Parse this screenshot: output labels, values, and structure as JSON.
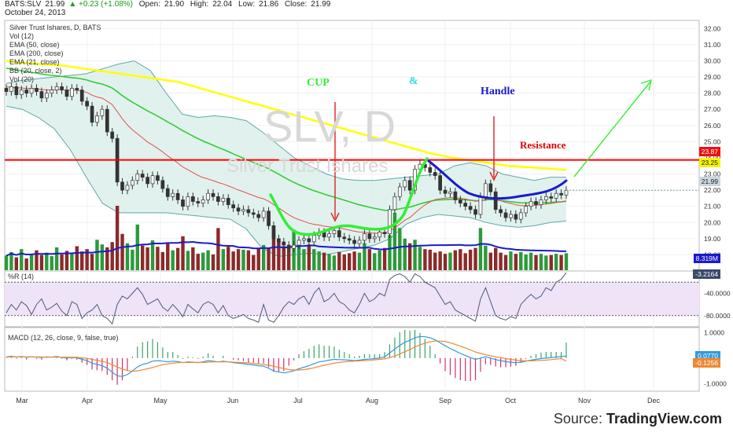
{
  "header": {
    "symbol": "BATS:SLV",
    "price": "21.99",
    "change": "▲ +0.23 (+1.08%)",
    "open_label": "Open:",
    "open": "21.90",
    "high_label": "High:",
    "high": "22.04",
    "low_label": "Low:",
    "low": "21.86",
    "close_label": "Close:",
    "close": "21.99",
    "date": "October 24, 2013"
  },
  "legend": [
    "Silver Trust Ishares, D, BATS",
    "Vol (12)",
    "EMA (50, close)",
    "EMA (200, close)",
    "EMA (21, close)",
    "BB (20, close, 2)",
    "Vol (20)"
  ],
  "watermark": {
    "big": "SLV, D",
    "small": "Silver Trust Ishares"
  },
  "annotations": {
    "cup": "CUP",
    "amp": "&",
    "handle": "Handle",
    "resistance": "Resistance"
  },
  "price_tags": {
    "resistance": "23.87",
    "ema200": "23.25",
    "last": "21.99",
    "volume": "8.319M"
  },
  "indicator_labels": {
    "wr": "%R (14)",
    "wr_last": "-3.2164",
    "macd": "MACD (12, 26, close, 9, false, true)",
    "macd_1": "0.0770",
    "macd_2": "-0.1256"
  },
  "source": {
    "prefix": "Source: ",
    "brand": "TradingView.com"
  },
  "colors": {
    "up": "#2e8b2e",
    "down": "#8b1a1a",
    "ema200": "#ffff00",
    "ema50": "#33cc33",
    "ema21": "#e05050",
    "bb": "#5fa8a8",
    "resistance": "#ff0000",
    "cup": "#33ee33",
    "handle": "#1a1acc",
    "arrow": "#33ee33",
    "macd": "#3399dd",
    "signal": "#ee8833"
  },
  "chart_data": {
    "type": "line",
    "title": "Silver Trust Ishares, D, BATS",
    "x_labels": [
      "Mar",
      "Apr",
      "May",
      "Jun",
      "Jul",
      "Aug",
      "Sep",
      "Oct",
      "Nov",
      "Dec"
    ],
    "price_axis": {
      "ylim": [
        17.0,
        32.5
      ],
      "ticks": [
        18.0,
        19.0,
        20.0,
        21.0,
        22.0,
        23.0,
        24.0,
        25.0,
        26.0,
        27.0,
        28.0,
        29.0,
        30.0,
        31.0,
        32.0
      ]
    },
    "wr_axis": {
      "ylim": [
        -100,
        0
      ],
      "ticks": [
        -40,
        -80
      ]
    },
    "macd_axis": {
      "ylim": [
        -1.3,
        1.2
      ],
      "ticks": [
        1.0,
        -1.0
      ]
    },
    "close_series": [
      28.1,
      28.4,
      27.9,
      28.2,
      28.0,
      28.3,
      28.1,
      27.7,
      28.0,
      28.2,
      28.4,
      28.2,
      27.8,
      28.3,
      28.2,
      27.5,
      27.2,
      26.2,
      26.6,
      27.0,
      25.6,
      25.2,
      22.5,
      22.0,
      22.3,
      22.6,
      23.0,
      22.8,
      22.4,
      22.9,
      22.6,
      22.1,
      21.6,
      21.8,
      21.4,
      21.0,
      21.6,
      21.3,
      21.2,
      21.4,
      21.8,
      21.6,
      21.3,
      21.5,
      21.1,
      20.9,
      20.7,
      20.8,
      20.6,
      20.5,
      20.3,
      20.7,
      19.8,
      19.0,
      18.8,
      18.6,
      18.4,
      18.6,
      18.9,
      19.0,
      18.8,
      19.2,
      19.4,
      19.1,
      19.3,
      19.5,
      19.1,
      19.0,
      18.9,
      18.7,
      18.9,
      19.3,
      19.0,
      19.1,
      19.4,
      19.3,
      20.8,
      21.6,
      22.2,
      22.6,
      22.0,
      23.3,
      23.6,
      23.4,
      23.1,
      22.9,
      22.0,
      21.8,
      21.9,
      21.4,
      21.2,
      21.0,
      20.8,
      20.5,
      21.6,
      22.4,
      21.9,
      20.8,
      20.6,
      20.3,
      20.5,
      20.2,
      20.6,
      21.0,
      21.3,
      21.1,
      21.4,
      21.6,
      21.5,
      21.8,
      21.7,
      21.99
    ],
    "ema200": [
      30.0,
      29.9,
      29.85,
      29.8,
      29.75,
      29.7,
      29.6,
      29.5,
      29.4,
      29.3,
      29.2,
      29.1,
      29.0,
      28.9,
      28.8,
      28.7,
      28.5,
      28.3,
      28.1,
      27.9,
      27.7,
      27.5,
      27.3,
      27.1,
      26.9,
      26.7,
      26.5,
      26.3,
      26.1,
      25.9,
      25.7,
      25.5,
      25.3,
      25.1,
      24.9,
      24.7,
      24.5,
      24.3,
      24.15,
      24.0,
      23.9,
      23.8,
      23.7,
      23.6,
      23.5,
      23.45,
      23.4,
      23.35,
      23.3,
      23.25
    ],
    "resistance": 23.87,
    "ema200_last": 23.25,
    "bb_upper": [
      28.6,
      28.8,
      28.9,
      29.0,
      29.1,
      29.2,
      29.5,
      29.8,
      30.0,
      29.4,
      28.0,
      26.7,
      26.5,
      26.6,
      26.5,
      26.3,
      25.6,
      24.8,
      24.0,
      23.5,
      23.0,
      22.7,
      22.6,
      22.6,
      22.7,
      22.8,
      22.9,
      23.0,
      23.5,
      23.7,
      23.5,
      23.0,
      22.8,
      22.6,
      22.8,
      22.8
    ],
    "bb_lower": [
      27.2,
      27.0,
      26.5,
      25.8,
      24.5,
      22.8,
      21.2,
      20.6,
      20.6,
      20.6,
      20.6,
      20.5,
      20.4,
      20.3,
      20.2,
      19.6,
      18.4,
      17.9,
      18.0,
      18.1,
      18.0,
      18.2,
      18.4,
      18.6,
      19.0,
      19.9,
      20.3,
      20.5,
      20.4,
      20.3,
      20.0,
      19.8,
      19.7,
      19.8,
      20.0,
      20.1
    ],
    "volume_max": 11,
    "volume_series": [
      2.5,
      3.1,
      2.2,
      3.6,
      2.0,
      2.8,
      3.4,
      2.6,
      3.0,
      2.4,
      3.9,
      2.7,
      3.3,
      2.9,
      4.1,
      3.2,
      3.6,
      2.8,
      5.2,
      4.4,
      3.9,
      4.8,
      11.0,
      6.2,
      4.6,
      3.5,
      7.8,
      4.2,
      3.9,
      5.1,
      4.0,
      3.1,
      4.6,
      3.4,
      3.8,
      5.8,
      3.3,
      3.9,
      2.8,
      3.0,
      3.4,
      2.7,
      7.2,
      3.6,
      4.0,
      3.2,
      3.6,
      3.5,
      3.4,
      2.6,
      3.8,
      4.3,
      3.7,
      6.4,
      5.0,
      4.1,
      3.8,
      6.9,
      4.2,
      3.6,
      4.4,
      3.6,
      3.2,
      3.0,
      2.8,
      2.5,
      3.1,
      2.7,
      2.9,
      3.2,
      3.0,
      4.6,
      3.6,
      2.9,
      3.4,
      3.8,
      6.0,
      9.8,
      7.2,
      5.4,
      4.6,
      5.2,
      4.0,
      3.6,
      3.5,
      3.0,
      3.2,
      2.8,
      3.0,
      3.4,
      3.6,
      2.9,
      3.5,
      3.8,
      7.2,
      4.2,
      3.0,
      3.8,
      3.0,
      2.6,
      3.2,
      2.8,
      3.1,
      2.7,
      3.0,
      2.6,
      2.8,
      2.5,
      2.6,
      2.8,
      2.6,
      2.9
    ],
    "wr_series": [
      -75,
      -60,
      -70,
      -55,
      -62,
      -78,
      -60,
      -50,
      -70,
      -65,
      -58,
      -72,
      -80,
      -55,
      -60,
      -85,
      -75,
      -70,
      -60,
      -80,
      -85,
      -95,
      -60,
      -45,
      -50,
      -40,
      -30,
      -42,
      -60,
      -55,
      -50,
      -65,
      -72,
      -60,
      -70,
      -82,
      -60,
      -68,
      -75,
      -60,
      -55,
      -60,
      -75,
      -62,
      -80,
      -85,
      -82,
      -78,
      -85,
      -88,
      -92,
      -60,
      -88,
      -92,
      -80,
      -65,
      -55,
      -60,
      -50,
      -45,
      -60,
      -40,
      -30,
      -55,
      -50,
      -40,
      -55,
      -60,
      -70,
      -75,
      -60,
      -40,
      -55,
      -50,
      -40,
      -45,
      -15,
      -8,
      -5,
      -10,
      -20,
      -5,
      -10,
      -20,
      -25,
      -30,
      -45,
      -60,
      -55,
      -70,
      -75,
      -80,
      -85,
      -90,
      -50,
      -30,
      -55,
      -80,
      -85,
      -88,
      -82,
      -85,
      -60,
      -50,
      -42,
      -50,
      -45,
      -30,
      -35,
      -20,
      -15,
      -3
    ],
    "macd_series": [
      0.05,
      0.07,
      0.04,
      0.06,
      0.03,
      0.05,
      0.04,
      0.02,
      0.05,
      0.04,
      0.06,
      0.03,
      0.0,
      0.02,
      0.01,
      -0.05,
      -0.1,
      -0.2,
      -0.25,
      -0.3,
      -0.4,
      -0.55,
      -0.7,
      -0.72,
      -0.65,
      -0.5,
      -0.35,
      -0.25,
      -0.2,
      -0.12,
      -0.1,
      -0.12,
      -0.15,
      -0.12,
      -0.14,
      -0.18,
      -0.15,
      -0.16,
      -0.18,
      -0.15,
      -0.1,
      -0.12,
      -0.15,
      -0.12,
      -0.15,
      -0.18,
      -0.2,
      -0.22,
      -0.25,
      -0.27,
      -0.3,
      -0.32,
      -0.4,
      -0.5,
      -0.55,
      -0.58,
      -0.55,
      -0.5,
      -0.42,
      -0.36,
      -0.3,
      -0.22,
      -0.15,
      -0.12,
      -0.08,
      -0.05,
      -0.06,
      -0.07,
      -0.08,
      -0.1,
      -0.08,
      -0.05,
      -0.04,
      -0.02,
      0.0,
      0.05,
      0.2,
      0.35,
      0.5,
      0.62,
      0.7,
      0.8,
      0.85,
      0.84,
      0.8,
      0.72,
      0.6,
      0.48,
      0.38,
      0.28,
      0.18,
      0.1,
      0.02,
      -0.05,
      0.0,
      0.05,
      0.0,
      -0.06,
      -0.1,
      -0.14,
      -0.16,
      -0.18,
      -0.16,
      -0.12,
      -0.08,
      -0.05,
      -0.02,
      0.0,
      0.02,
      0.04,
      0.06,
      0.077
    ],
    "signal_series": [
      0.04,
      0.05,
      0.05,
      0.05,
      0.05,
      0.05,
      0.05,
      0.04,
      0.04,
      0.04,
      0.04,
      0.04,
      0.03,
      0.03,
      0.03,
      0.01,
      -0.01,
      -0.05,
      -0.09,
      -0.13,
      -0.18,
      -0.26,
      -0.35,
      -0.43,
      -0.49,
      -0.52,
      -0.5,
      -0.46,
      -0.42,
      -0.37,
      -0.31,
      -0.26,
      -0.23,
      -0.2,
      -0.18,
      -0.17,
      -0.17,
      -0.17,
      -0.17,
      -0.17,
      -0.16,
      -0.15,
      -0.15,
      -0.15,
      -0.15,
      -0.16,
      -0.17,
      -0.18,
      -0.19,
      -0.21,
      -0.23,
      -0.25,
      -0.28,
      -0.32,
      -0.37,
      -0.41,
      -0.45,
      -0.47,
      -0.47,
      -0.45,
      -0.42,
      -0.38,
      -0.33,
      -0.28,
      -0.24,
      -0.2,
      -0.17,
      -0.15,
      -0.13,
      -0.12,
      -0.11,
      -0.1,
      -0.09,
      -0.07,
      -0.05,
      -0.03,
      0.02,
      0.08,
      0.16,
      0.25,
      0.34,
      0.43,
      0.52,
      0.59,
      0.64,
      0.67,
      0.67,
      0.65,
      0.6,
      0.54,
      0.47,
      0.4,
      0.32,
      0.24,
      0.18,
      0.13,
      0.09,
      0.05,
      0.02,
      -0.02,
      -0.05,
      -0.08,
      -0.1,
      -0.11,
      -0.11,
      -0.1,
      -0.09,
      -0.08,
      -0.06,
      -0.04,
      -0.02,
      -0.1256
    ]
  }
}
